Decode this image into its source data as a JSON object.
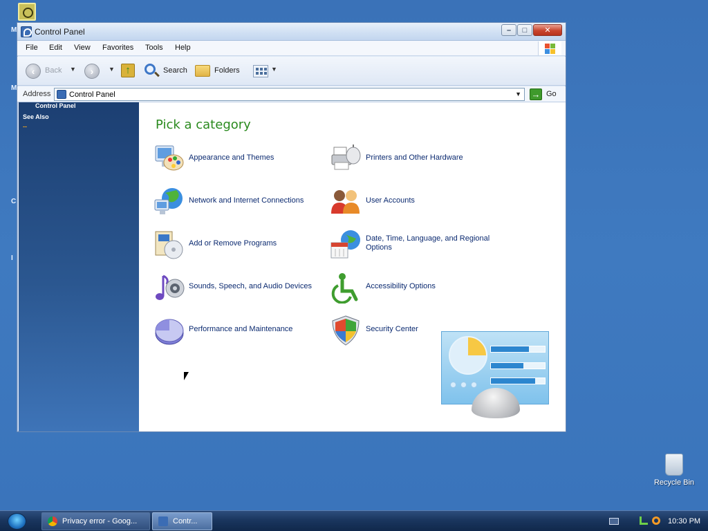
{
  "window": {
    "title": "Control Panel"
  },
  "menu": [
    "File",
    "Edit",
    "View",
    "Favorites",
    "Tools",
    "Help"
  ],
  "toolbar": {
    "back_label": "Back",
    "search_label": "Search",
    "folders_label": "Folders"
  },
  "address": {
    "label": "Address",
    "value": "Control Panel",
    "go_label": "Go"
  },
  "sidebar": {
    "items": [
      "Control Panel",
      "See Also"
    ],
    "dash": "--"
  },
  "content": {
    "heading": "Pick a category",
    "categories": [
      "Appearance and Themes",
      "Printers and Other Hardware",
      "Network and Internet Connections",
      "User Accounts",
      "Add or Remove Programs",
      "Date, Time, Language, and Regional Options",
      "Sounds, Speech, and Audio Devices",
      "Accessibility Options",
      "Performance and Maintenance",
      "Security Center"
    ]
  },
  "desktop": {
    "recycle_bin_label": "Recycle Bin"
  },
  "taskbar": {
    "buttons": [
      "Privacy error - Goog...",
      "Contr..."
    ],
    "clock": "10:30 PM"
  },
  "colors": {
    "desktop": "#3b73b9",
    "heading_green": "#2a8a1e",
    "link_blue": "#0b2a70",
    "sidebar_top": "#1c3f72"
  }
}
